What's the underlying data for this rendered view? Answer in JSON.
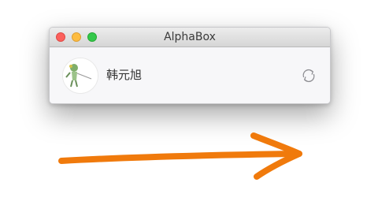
{
  "window": {
    "title": "AlphaBox"
  },
  "account": {
    "name": "韩元旭",
    "avatar_icon": "avatar-illustration",
    "refresh_icon": "refresh-icon"
  },
  "annotation": {
    "arrow_icon": "hand-drawn-arrow-icon",
    "arrow_color": "#f07a0c"
  }
}
